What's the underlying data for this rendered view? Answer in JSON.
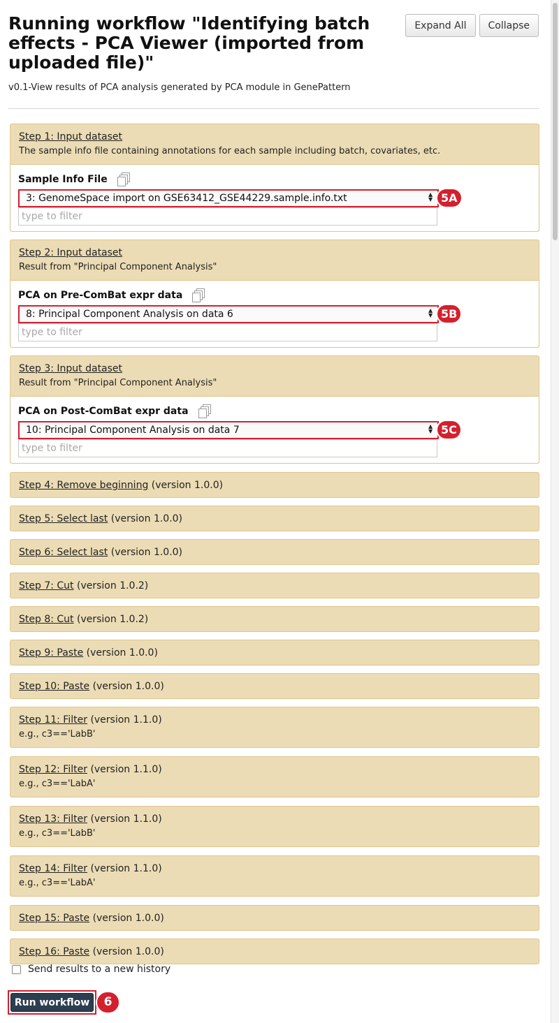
{
  "header": {
    "title": "Running workflow \"Identifying batch effects - PCA Viewer (imported from uploaded file)\"",
    "subtitle": "v0.1-View results of PCA analysis generated by PCA module in GenePattern",
    "expand_all": "Expand All",
    "collapse": "Collapse"
  },
  "steps": [
    {
      "link": "Step 1: Input dataset",
      "desc": "The sample info file containing annotations for each sample including batch, covariates, etc.",
      "field_label": "Sample Info File",
      "selected": "3: GenomeSpace import on GSE63412_GSE44229.sample.info.txt",
      "placeholder": "type to filter",
      "badge": "5A"
    },
    {
      "link": "Step 2: Input dataset",
      "desc": "Result from \"Principal Component Analysis\"",
      "field_label": "PCA on Pre-ComBat expr data",
      "selected": "8: Principal Component Analysis on data 6",
      "placeholder": "type to filter",
      "badge": "5B"
    },
    {
      "link": "Step 3: Input dataset",
      "desc": "Result from \"Principal Component Analysis\"",
      "field_label": "PCA on Post-ComBat expr data",
      "selected": "10: Principal Component Analysis on data 7",
      "placeholder": "type to filter",
      "badge": "5C"
    },
    {
      "link": "Step 4: Remove beginning",
      "version": "(version 1.0.0)"
    },
    {
      "link": "Step 5: Select last",
      "version": "(version 1.0.0)"
    },
    {
      "link": "Step 6: Select last",
      "version": "(version 1.0.0)"
    },
    {
      "link": "Step 7: Cut",
      "version": "(version 1.0.2)"
    },
    {
      "link": "Step 8: Cut",
      "version": "(version 1.0.2)"
    },
    {
      "link": "Step 9: Paste",
      "version": "(version 1.0.0)"
    },
    {
      "link": "Step 10: Paste",
      "version": "(version 1.0.0)"
    },
    {
      "link": "Step 11: Filter",
      "version": "(version 1.1.0)",
      "desc": "e.g., c3=='LabB'"
    },
    {
      "link": "Step 12: Filter",
      "version": "(version 1.1.0)",
      "desc": "e.g., c3=='LabA'"
    },
    {
      "link": "Step 13: Filter",
      "version": "(version 1.1.0)",
      "desc": "e.g., c3=='LabB'"
    },
    {
      "link": "Step 14: Filter",
      "version": "(version 1.1.0)",
      "desc": "e.g., c3=='LabA'"
    },
    {
      "link": "Step 15: Paste",
      "version": "(version 1.0.0)"
    },
    {
      "link": "Step 16: Paste",
      "version": "(version 1.0.0)"
    }
  ],
  "footer": {
    "send_results_label": "Send results to a new history",
    "run_button": "Run workflow",
    "run_badge": "6"
  },
  "colors": {
    "step_bg": "#ecdcb5",
    "step_border": "#dfc58a",
    "highlight": "#d4202e",
    "run_button": "#2c3e50"
  },
  "icons": [
    "copy-icon",
    "select-arrows-icon"
  ]
}
